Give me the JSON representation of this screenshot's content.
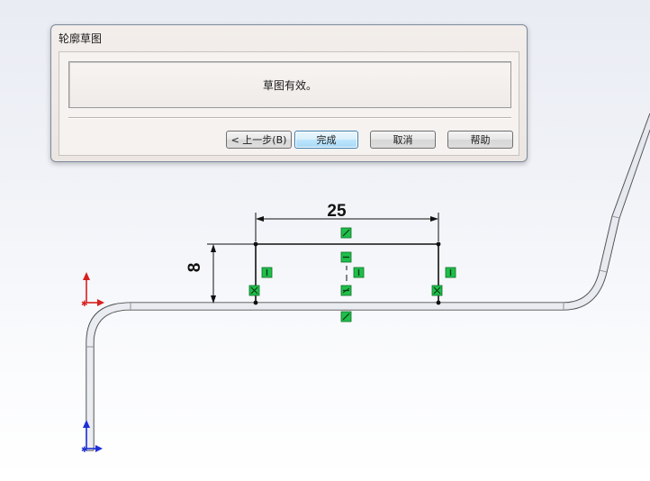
{
  "dialog": {
    "title": "轮廓草图",
    "message": "草图有效。",
    "buttons": {
      "back": "< 上一步(B)",
      "finish": "完成",
      "cancel": "取消",
      "help": "帮助"
    }
  },
  "sketch": {
    "dimension_width": "25",
    "dimension_height": "8"
  },
  "colors": {
    "relation_marker": "#1fbf4a",
    "axis_x": "#d81f1f",
    "axis_y": "#1e2fd8",
    "profile": "#2b2b2b"
  }
}
